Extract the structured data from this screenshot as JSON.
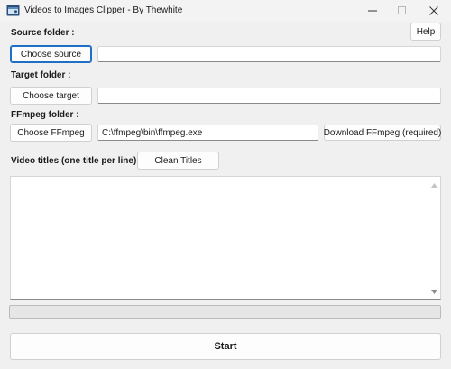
{
  "window": {
    "title": "Videos to Images Clipper - By Thewhite",
    "icon": "film-clapper-icon",
    "controls": {
      "minimize": "minimize-icon",
      "maximize": "maximize-icon",
      "close": "close-icon"
    }
  },
  "help_button": "Help",
  "source": {
    "label": "Source folder :",
    "button": "Choose source",
    "path": ""
  },
  "target": {
    "label": "Target folder :",
    "button": "Choose target",
    "path": ""
  },
  "ffmpeg": {
    "label": "FFmpeg folder :",
    "button": "Choose FFmpeg",
    "path": "C:\\ffmpeg\\bin\\ffmpeg.exe",
    "download_button": "Download FFmpeg (required)"
  },
  "titles": {
    "label": "Video titles (one title per line):",
    "clean_button": "Clean Titles",
    "content": ""
  },
  "progress": {
    "value": 0
  },
  "start_button": "Start",
  "colors": {
    "accent": "#1f6fc5",
    "progress": "#06b025"
  }
}
